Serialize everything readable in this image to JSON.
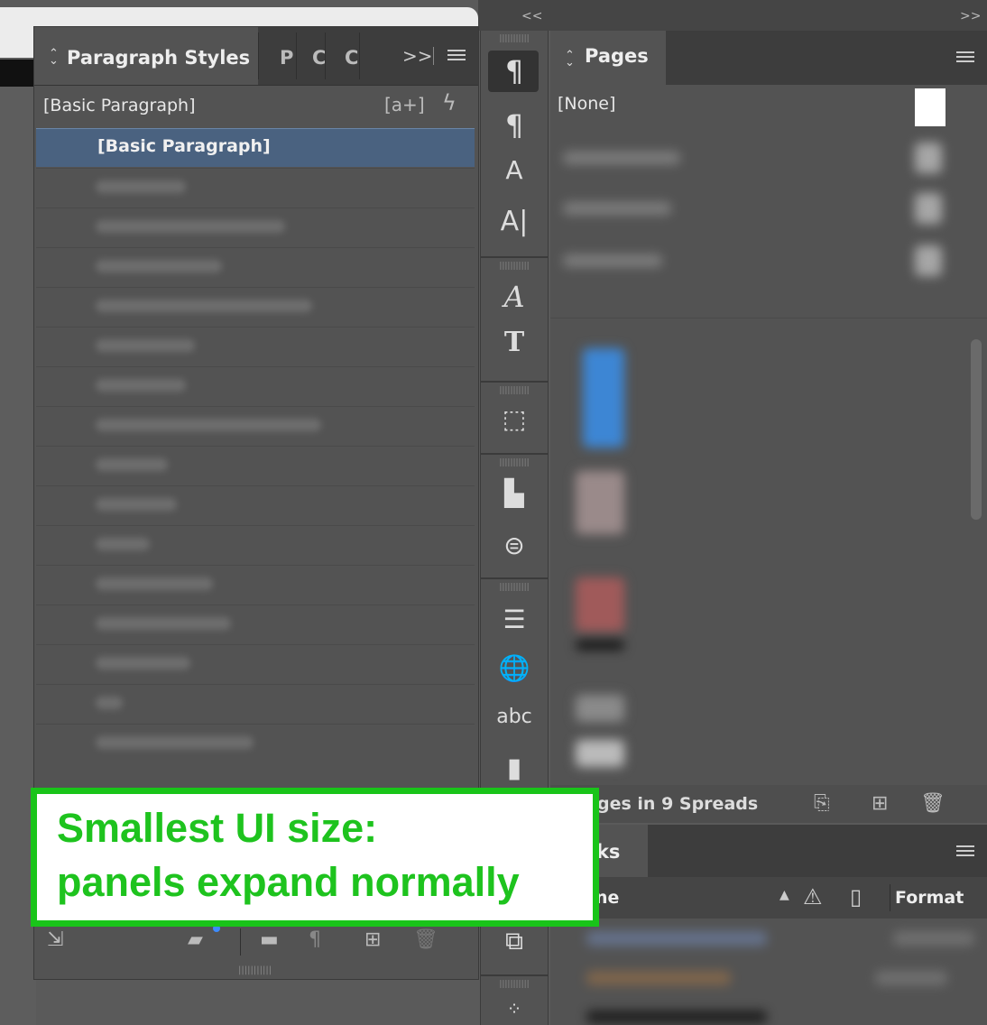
{
  "paragraph_panel": {
    "title": "Paragraph Styles",
    "tab2": "P",
    "tab3": "C",
    "tab4": "C",
    "more_tabs": ">>",
    "current_style": "[Basic Paragraph]",
    "new_style_icon": "[a+]",
    "selected_style": "[Basic Paragraph]",
    "icons": [
      "updown-icon",
      "menu-icon",
      "quick-apply-icon",
      "load-styles-icon",
      "clear-override-icon",
      "new-group-icon",
      "new-style-icon",
      "delete-icon"
    ]
  },
  "collapse_left": "<<",
  "collapse_right": ">>",
  "pages_panel": {
    "title": "Pages",
    "none_label": "[None]",
    "status": "ges in 9 Spreads"
  },
  "links_panel": {
    "title": "nks",
    "name_header": "ne",
    "format_header": "Format"
  },
  "callout": {
    "line1": "Smallest UI size:",
    "line2": "panels expand normally"
  },
  "colors": {
    "callout_green": "#1ec31e",
    "selection_blue": "#4a6280",
    "panel_bg": "#535353"
  }
}
